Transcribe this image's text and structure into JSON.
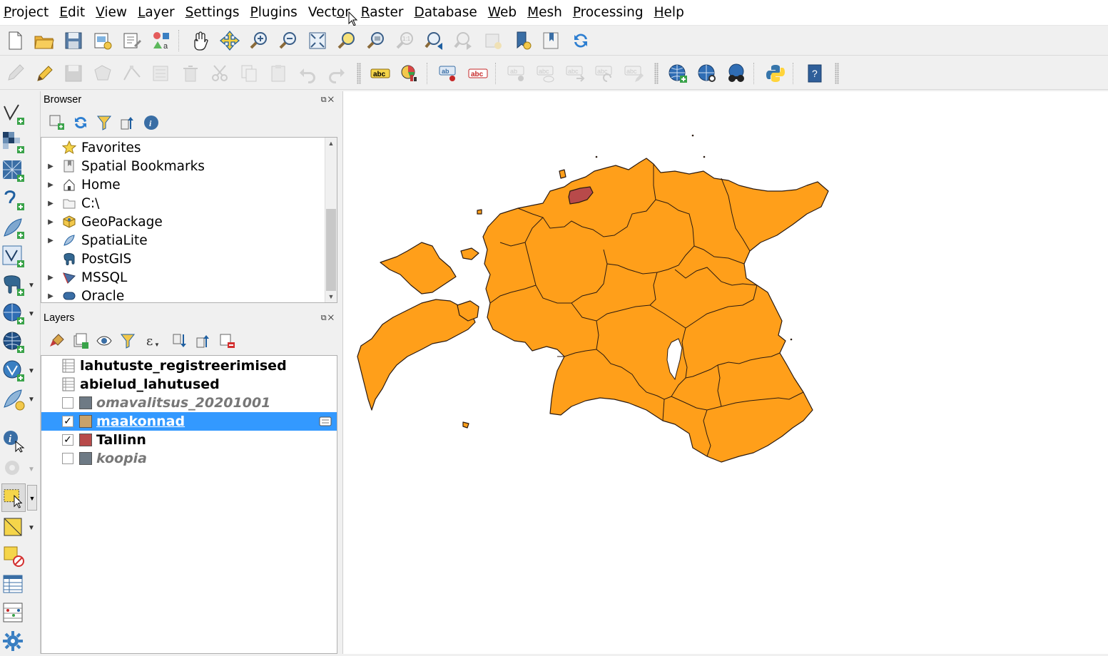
{
  "menu": [
    {
      "label": "Project",
      "ul": "P"
    },
    {
      "label": "Edit",
      "ul": "E"
    },
    {
      "label": "View",
      "ul": "V"
    },
    {
      "label": "Layer",
      "ul": "L"
    },
    {
      "label": "Settings",
      "ul": "S"
    },
    {
      "label": "Plugins",
      "ul": "P"
    },
    {
      "label": "Vector",
      "ul": "o"
    },
    {
      "label": "Raster",
      "ul": "R"
    },
    {
      "label": "Database",
      "ul": "D"
    },
    {
      "label": "Web",
      "ul": "W"
    },
    {
      "label": "Mesh",
      "ul": "M"
    },
    {
      "label": "Processing",
      "ul": "P"
    },
    {
      "label": "Help",
      "ul": "H"
    }
  ],
  "label_tools": {
    "abc_yellow": "abc",
    "abc_red": "abc",
    "ab_pin": "ab",
    "abc_disabled": "abc"
  },
  "browser": {
    "title": "Browser",
    "items": [
      {
        "label": "Favorites",
        "icon": "star-icon",
        "expandable": false
      },
      {
        "label": "Spatial Bookmarks",
        "icon": "bookmark-icon",
        "expandable": true
      },
      {
        "label": "Home",
        "icon": "home-icon",
        "expandable": true
      },
      {
        "label": "C:\\",
        "icon": "folder-icon",
        "expandable": true
      },
      {
        "label": "GeoPackage",
        "icon": "geopackage-icon",
        "expandable": true
      },
      {
        "label": "SpatiaLite",
        "icon": "spatialite-icon",
        "expandable": true
      },
      {
        "label": "PostGIS",
        "icon": "postgis-elephant-icon",
        "expandable": false
      },
      {
        "label": "MSSQL",
        "icon": "mssql-icon",
        "expandable": true
      },
      {
        "label": "Oracle",
        "icon": "oracle-icon",
        "expandable": true
      }
    ]
  },
  "layers": {
    "title": "Layers",
    "items": [
      {
        "label": "lahutuste_registreerimised",
        "kind": "table",
        "visible": null,
        "style": "bold"
      },
      {
        "label": "abielud_lahutused",
        "kind": "table",
        "visible": null,
        "style": "bold"
      },
      {
        "label": "omavalitsus_20201001",
        "kind": "polygon",
        "visible": false,
        "color": "#6e7a85",
        "style": "italic"
      },
      {
        "label": "maakonnad",
        "kind": "polygon",
        "visible": true,
        "color": "#c8a26a",
        "style": "selected"
      },
      {
        "label": "Tallinn",
        "kind": "polygon",
        "visible": true,
        "color": "#b84a4a",
        "style": "bold"
      },
      {
        "label": "koopia",
        "kind": "polygon",
        "visible": false,
        "color": "#6e7a85",
        "style": "italic"
      }
    ]
  },
  "dock_controls": "⧉✕",
  "check_mark": "✓",
  "map": {
    "fill": "#ff9f1a",
    "highlight": "#b84a4a",
    "stroke": "#2b1a10"
  }
}
